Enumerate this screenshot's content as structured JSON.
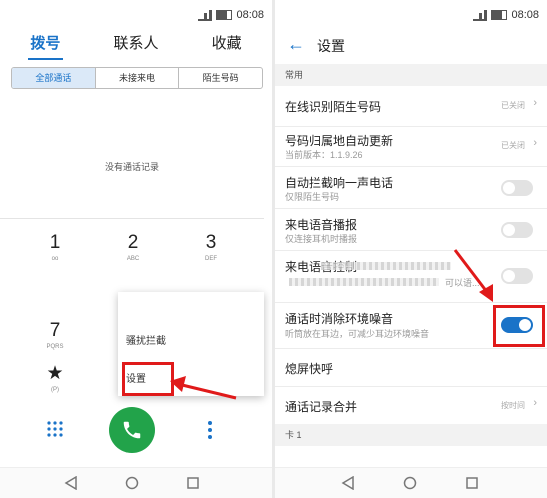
{
  "left": {
    "statusbar": {
      "time": "08:08"
    },
    "tabs": [
      {
        "label": "拨号",
        "active": true
      },
      {
        "label": "联系人",
        "active": false
      },
      {
        "label": "收藏",
        "active": false
      }
    ],
    "filters": [
      {
        "label": "全部通话",
        "active": true
      },
      {
        "label": "未接来电",
        "active": false
      },
      {
        "label": "陌生号码",
        "active": false
      }
    ],
    "empty_text": "没有通话记录",
    "keys": [
      {
        "num": "1",
        "sub": "oo"
      },
      {
        "num": "2",
        "sub": "ABC"
      },
      {
        "num": "3",
        "sub": "DEF"
      },
      {
        "num": "7",
        "sub": "PQRS"
      },
      {
        "num": "★",
        "sub": "(P)"
      }
    ],
    "menu": [
      {
        "label": "骚扰拦截"
      },
      {
        "label": "设置"
      }
    ]
  },
  "right": {
    "statusbar": {
      "time": "08:08"
    },
    "header": {
      "title": "设置"
    },
    "section_common": "常用",
    "rows": [
      {
        "title": "在线识别陌生号码",
        "subtitle": "",
        "value": "已关闭",
        "control": "chevron"
      },
      {
        "title": "号码归属地自动更新",
        "subtitle": "当前版本：1.1.9.26",
        "value": "已关闭",
        "control": "chevron"
      },
      {
        "title": "自动拦截响一声电话",
        "subtitle": "仅限陌生号码",
        "value": "",
        "control": "toggle-off"
      },
      {
        "title": "来电语音播报",
        "subtitle": "仅连接耳机时播报",
        "value": "",
        "control": "toggle-off"
      },
      {
        "title": "来电语音控制",
        "subtitle": "可以语...",
        "value": "",
        "control": "toggle-off"
      },
      {
        "title": "通话时消除环境噪音",
        "subtitle": "听筒放在耳边，可减少耳边环境噪音",
        "value": "",
        "control": "toggle-on"
      },
      {
        "title": "熄屏快呼",
        "subtitle": "",
        "value": "",
        "control": "none"
      },
      {
        "title": "通话记录合并",
        "subtitle": "",
        "value": "按时间",
        "control": "chevron"
      }
    ],
    "section_card": "卡 1"
  },
  "colors": {
    "accent": "#1a73c8",
    "call_green": "#22a34a",
    "highlight_red": "#e01a1a"
  }
}
